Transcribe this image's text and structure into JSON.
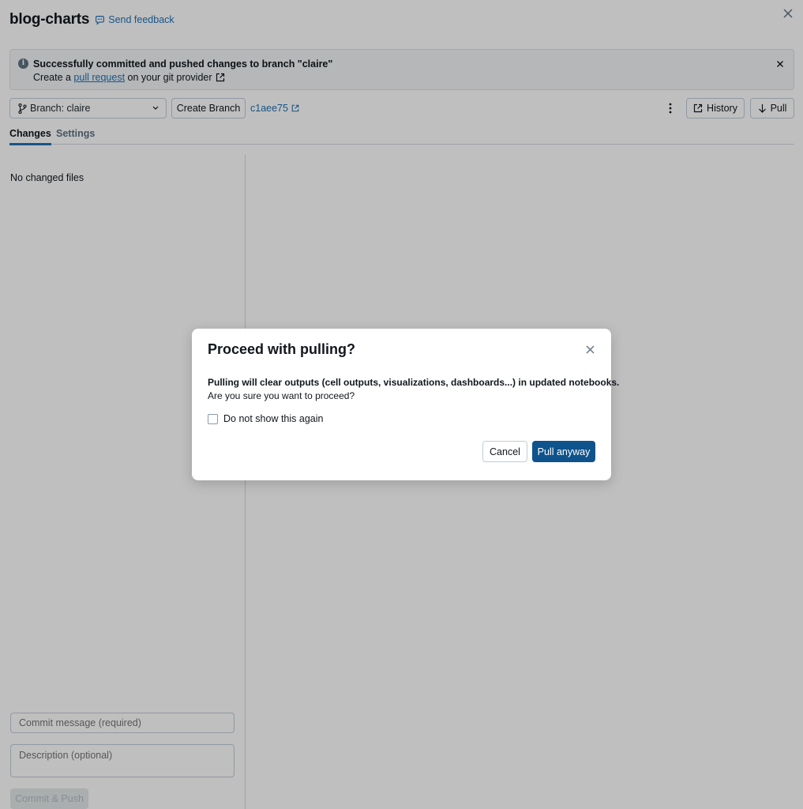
{
  "header": {
    "title": "blog-charts",
    "feedback_label": "Send feedback"
  },
  "banner": {
    "title": "Successfully committed and pushed changes to branch \"claire\"",
    "sub_prefix": "Create a ",
    "sub_link": "pull request",
    "sub_suffix": " on your git provider"
  },
  "toolbar": {
    "branch_label": "Branch: claire",
    "create_branch_label": "Create Branch",
    "commit_hash": "c1aee75",
    "history_label": "History",
    "pull_label": "Pull"
  },
  "tabs": [
    {
      "label": "Changes",
      "active": true
    },
    {
      "label": "Settings",
      "active": false
    }
  ],
  "changes": {
    "empty_text": "No changed files",
    "commit_placeholder": "Commit message (required)",
    "description_placeholder": "Description (optional)",
    "commit_push_label": "Commit & Push"
  },
  "modal": {
    "title": "Proceed with pulling?",
    "bold_text": "Pulling will clear outputs (cell outputs, visualizations, dashboards...) in updated notebooks.",
    "text": "Are you sure you want to proceed?",
    "checkbox_label": "Do not show this again",
    "checkbox_checked": false,
    "cancel_label": "Cancel",
    "confirm_label": "Pull anyway"
  },
  "colors": {
    "accent": "#2272b4",
    "primary_button": "#0e538b"
  }
}
